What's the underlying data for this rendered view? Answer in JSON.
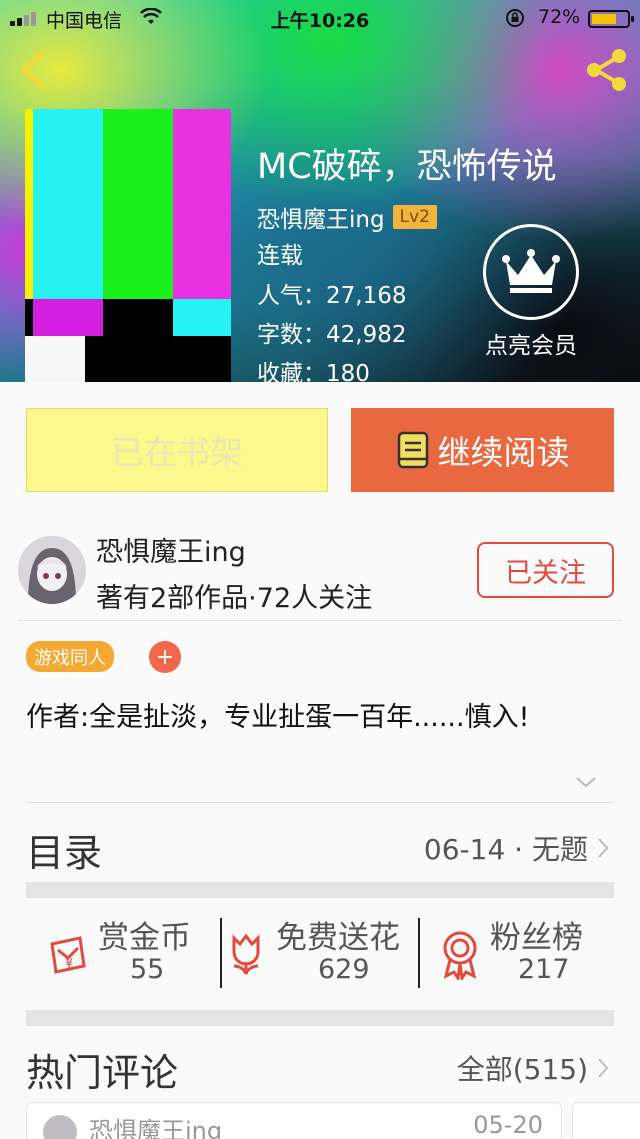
{
  "status_bar": {
    "carrier": "中国电信",
    "time": "上午10:26",
    "battery": "72%",
    "battery_level": 0.72
  },
  "header": {
    "back_icon": "chevron-left-icon",
    "share_icon": "share-icon"
  },
  "book": {
    "title": "MC破碎，恐怖传说",
    "author": "恐惧魔王ing",
    "author_level": "Lv2",
    "status": "连载",
    "popularity": "人气：27,168",
    "word_count": "字数：42,982",
    "favorites": "收藏：180"
  },
  "vip": {
    "icon": "crown-icon",
    "label": "点亮会员"
  },
  "actions": {
    "shelf_label": "已在书架",
    "read_label": "继续阅读",
    "read_icon": "book-icon"
  },
  "author_info": {
    "name": "恐惧魔王ing",
    "stats": "著有2部作品·72人关注",
    "follow_label": "已关注"
  },
  "tags": {
    "items": [
      "游戏同人"
    ],
    "add_label": "+"
  },
  "intro": {
    "text": "作者:全是扯淡，专业扯蛋一百年......慎入!"
  },
  "toc": {
    "label": "目录",
    "latest": "06-14 · 无题"
  },
  "stats": {
    "reward": {
      "title": "赏金币",
      "value": "55",
      "icon": "red-envelope-icon"
    },
    "flowers": {
      "title": "免费送花",
      "value": "629",
      "icon": "flower-icon"
    },
    "fans": {
      "title": "粉丝榜",
      "value": "217",
      "icon": "medal-icon"
    }
  },
  "comments": {
    "label": "热门评论",
    "all_label": "全部(515)",
    "items": [
      {
        "user": "恐惧魔王ing",
        "date": "05-20"
      }
    ]
  },
  "colors": {
    "accent_orange": "#e8693f",
    "shelf_yellow": "#fdf88d",
    "follow_red": "#e24b3c",
    "tag_orange": "#f6a932"
  }
}
